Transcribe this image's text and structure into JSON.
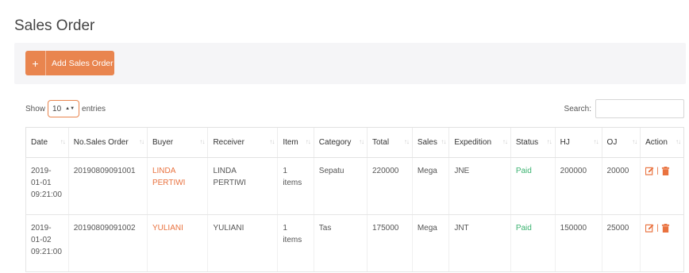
{
  "page": {
    "title": "Sales Order"
  },
  "toolbar": {
    "add_plus": "+",
    "add_label": "Add Sales Order"
  },
  "table_controls": {
    "show_label": "Show",
    "length_value": "10",
    "entries_label": "entries",
    "search_label": "Search:",
    "search_value": ""
  },
  "columns": [
    "Date",
    "No.Sales Order",
    "Buyer",
    "Receiver",
    "Item",
    "Category",
    "Total",
    "Sales",
    "Expedition",
    "Status",
    "HJ",
    "OJ",
    "Action"
  ],
  "rows": [
    {
      "date_line1": "2019-",
      "date_line2": "01-01",
      "date_line3": "09:21:00",
      "order_no": "20190809091001",
      "buyer_line1": "LINDA",
      "buyer_line2": "PERTIWI",
      "receiver_line1": "LINDA",
      "receiver_line2": "PERTIWI",
      "item_line1": "1",
      "item_line2": "items",
      "category": "Sepatu",
      "total": "220000",
      "sales": "Mega",
      "expedition": "JNE",
      "status": "Paid",
      "hj": "200000",
      "oj": "20000",
      "action_sep": "|"
    },
    {
      "date_line1": "2019-",
      "date_line2": "01-02",
      "date_line3": "09:21:00",
      "order_no": "20190809091002",
      "buyer_line1": "YULIANI",
      "buyer_line2": "",
      "receiver_line1": "YULIANI",
      "receiver_line2": "",
      "item_line1": "1",
      "item_line2": "items",
      "category": "Tas",
      "total": "175000",
      "sales": "Mega",
      "expedition": "JNT",
      "status": "Paid",
      "hj": "150000",
      "oj": "25000",
      "action_sep": "|"
    }
  ],
  "colors": {
    "accent": "#e9854f",
    "buyer": "#e9723f",
    "paid": "#3cb371"
  },
  "icons": {
    "add": "plus-icon",
    "edit": "edit-icon",
    "delete": "trash-icon",
    "sort": "sort-icon",
    "select": "chevron-down-icon"
  }
}
